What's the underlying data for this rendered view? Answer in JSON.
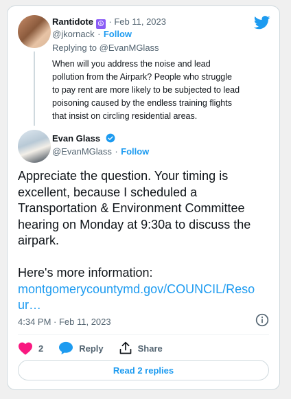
{
  "reply_tweet": {
    "display_name": "Rantidote",
    "emoji": "☮",
    "date": "· Feb 11, 2023",
    "handle": "@jkornack",
    "follow_label": "Follow",
    "replying_prefix": "Replying to ",
    "replying_to": "@EvanMGlass",
    "text_lines": [
      "When will you address the noise and lead",
      "pollution from the Airpark? People who struggle",
      "to pay rent are more likely to be subjected to lead",
      "poisoning caused by the endless training flights",
      "that insist on circling residential areas."
    ]
  },
  "main_tweet": {
    "display_name": "Evan Glass",
    "handle": "@EvanMGlass",
    "follow_label": "Follow",
    "text_lines": [
      "Appreciate the question. Your timing is",
      "excellent, because I scheduled a",
      "Transportation & Environment Committee",
      "hearing on Monday at 9:30a to discuss the",
      "airpark."
    ],
    "more_info": "Here's more information:",
    "link_lines": [
      "montgomerycountymd.gov/COUNCIL/Reso",
      "ur…"
    ],
    "timestamp": "4:34 PM · Feb 11, 2023"
  },
  "actions": {
    "like_count": "2",
    "reply_label": "Reply",
    "share_label": "Share",
    "read_replies_label": "Read 2 replies"
  },
  "colors": {
    "accent": "#1d9bf0",
    "like": "#f91880",
    "text": "#0f1419",
    "muted": "#536471"
  },
  "icons": [
    "twitter-bird-icon",
    "verified-badge-icon",
    "info-icon",
    "heart-icon",
    "reply-bubble-icon",
    "share-icon"
  ]
}
